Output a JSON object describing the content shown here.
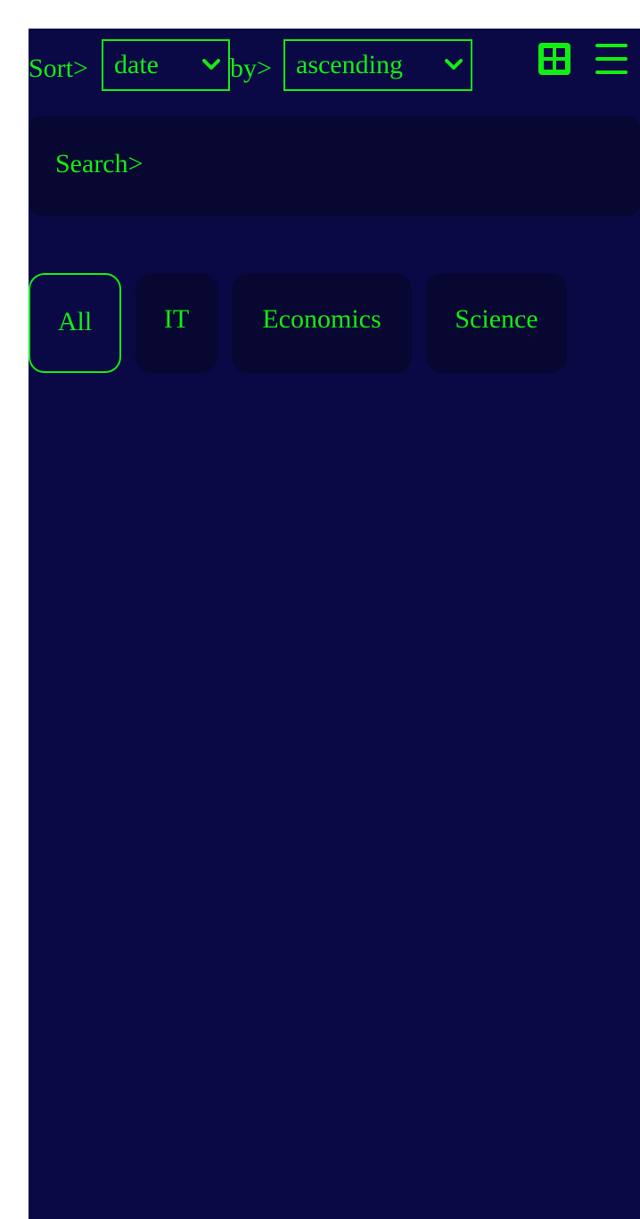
{
  "sort_bar": {
    "sort_label": "Sort>",
    "sort_field_value": "date",
    "by_label": "by>",
    "sort_order_value": "ascending"
  },
  "view_toggles": {
    "grid_icon": "grid-view-icon",
    "list_icon": "menu-list-icon"
  },
  "search": {
    "label": "Search>"
  },
  "categories": [
    {
      "label": "All",
      "active": true
    },
    {
      "label": "IT",
      "active": false
    },
    {
      "label": "Economics",
      "active": false
    },
    {
      "label": "Science",
      "active": false
    }
  ],
  "colors": {
    "accent": "#11ee11",
    "background": "#0a0945",
    "surface": "#070731",
    "page": "#ffffff"
  }
}
